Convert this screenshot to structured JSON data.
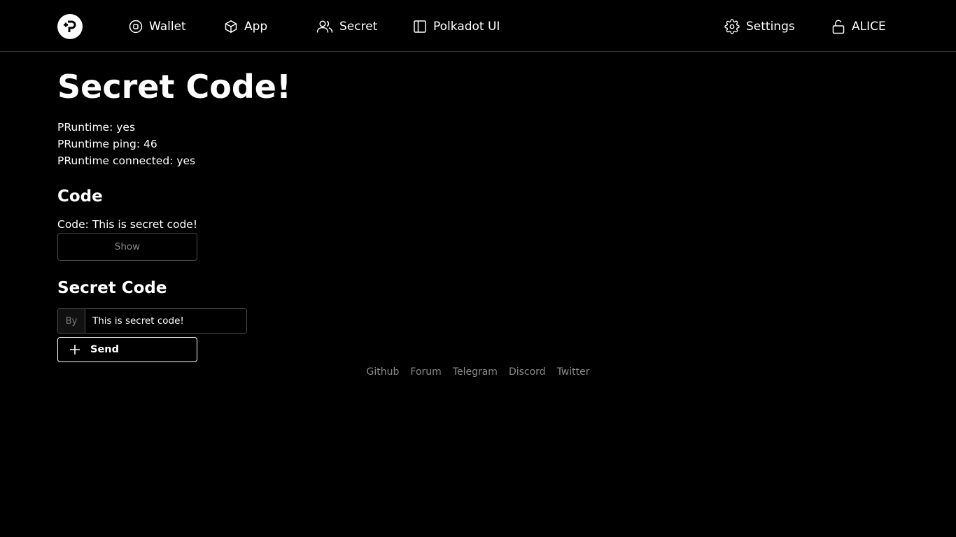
{
  "header": {
    "nav": [
      {
        "label": "Wallet",
        "icon": "wallet-icon"
      },
      {
        "label": "App",
        "icon": "box-icon"
      },
      {
        "label": "Secret",
        "icon": "users-icon"
      },
      {
        "label": "Polkadot UI",
        "icon": "sidebar-icon"
      }
    ],
    "settings_label": "Settings",
    "account_label": "ALICE"
  },
  "main": {
    "title": "Secret Code!",
    "status": {
      "pruntime": "PRuntime: yes",
      "ping": "PRuntime ping: 46",
      "connected": "PRuntime connected: yes"
    },
    "code_section": {
      "heading": "Code",
      "code_text": "Code: This is secret code!",
      "show_label": "Show"
    },
    "secret_section": {
      "heading": "Secret Code",
      "input_addon": "By",
      "input_value": "This is secret code!",
      "send_label": "Send"
    }
  },
  "footer": {
    "links": [
      "Github",
      "Forum",
      "Telegram",
      "Discord",
      "Twitter"
    ]
  },
  "colors": {
    "background": "#000000",
    "text": "#ffffff",
    "muted": "#8a8a8a",
    "border": "#4a4a4a"
  }
}
